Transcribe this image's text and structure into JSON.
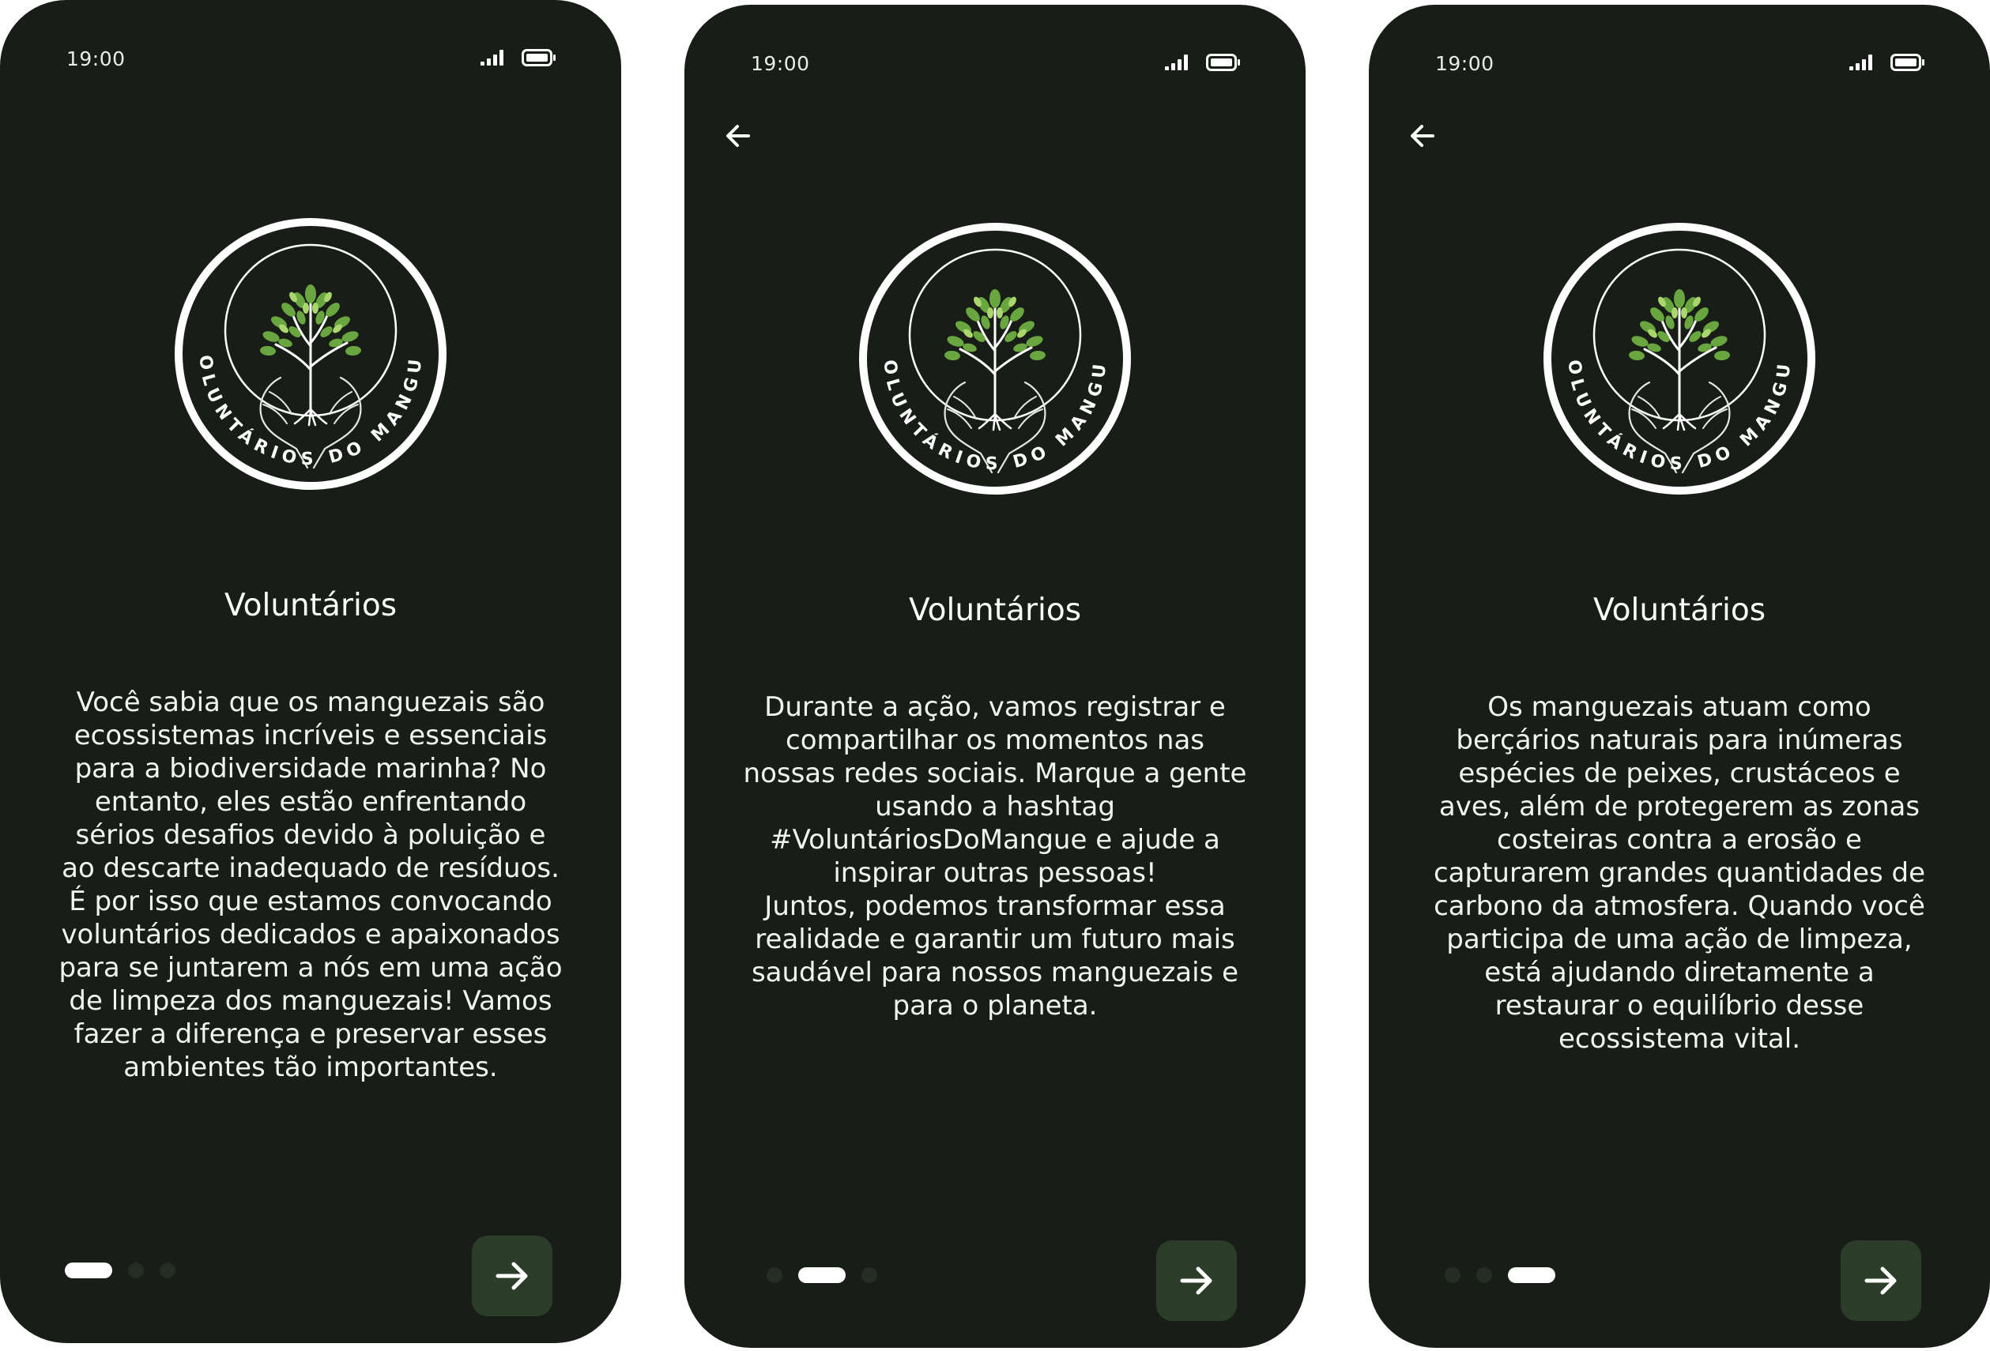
{
  "colors": {
    "screen_bg": "#181e17",
    "button_bg": "#2c3d2a",
    "dot_inactive": "#262d25",
    "dot_active": "#ffffff",
    "text": "#ffffff",
    "leaf_green": "#6aa640"
  },
  "icons": {
    "signal": "signal-icon",
    "battery": "battery-icon",
    "back": "arrow-left-icon",
    "next": "arrow-right-icon",
    "logo": "tree-in-hands-logo"
  },
  "logo": {
    "ring_text": "VOLUNTÁRIOS DO MANGUE"
  },
  "screens": [
    {
      "time": "19:00",
      "has_back": false,
      "title": "Voluntários",
      "body": "Você sabia que os manguezais são ecossistemas incríveis e essenciais para a biodiversidade marinha? No entanto, eles estão enfrentando sérios desafios devido à poluição e ao descarte inadequado de resíduos. É por isso que estamos convocando voluntários dedicados e apaixonados para se juntarem a nós em uma ação de limpeza dos manguezais! Vamos fazer a diferença e preservar esses ambientes tão importantes.",
      "page_index": 0,
      "page_count": 3
    },
    {
      "time": "19:00",
      "has_back": true,
      "title": "Voluntários",
      "body": "Durante a ação, vamos registrar e compartilhar os momentos nas nossas redes sociais. Marque a gente usando a hashtag #VoluntáriosDoMangue e ajude a inspirar outras pessoas!\nJuntos, podemos transformar essa realidade e garantir um futuro mais saudável para nossos manguezais e para o planeta.",
      "page_index": 1,
      "page_count": 3
    },
    {
      "time": "19:00",
      "has_back": true,
      "title": "Voluntários",
      "body": "Os manguezais atuam como berçários naturais para inúmeras espécies de peixes, crustáceos e aves, além de protegerem as zonas costeiras contra a erosão e capturarem grandes quantidades de carbono da atmosfera. Quando você participa de uma ação de limpeza, está ajudando diretamente a restaurar o equilíbrio desse ecossistema vital.",
      "page_index": 2,
      "page_count": 3
    }
  ]
}
